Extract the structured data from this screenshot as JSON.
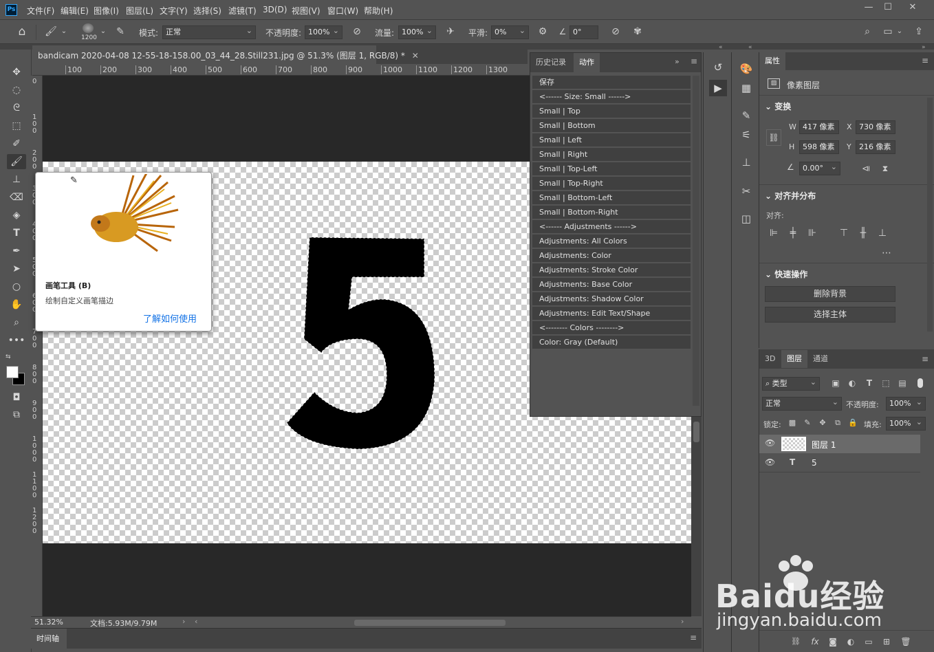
{
  "app": {
    "logo": "Ps"
  },
  "menu": [
    "文件(F)",
    "编辑(E)",
    "图像(I)",
    "图层(L)",
    "文字(Y)",
    "选择(S)",
    "滤镜(T)",
    "3D(D)",
    "视图(V)",
    "窗口(W)",
    "帮助(H)"
  ],
  "window_controls": {
    "minimize": "—",
    "maximize": "☐",
    "close": "✕"
  },
  "options": {
    "brush_size": "1200",
    "mode_label": "模式:",
    "mode_value": "正常",
    "opacity_label": "不透明度:",
    "opacity_value": "100%",
    "flow_label": "流量:",
    "flow_value": "100%",
    "smooth_label": "平滑:",
    "smooth_value": "0%",
    "angle_value": "0°"
  },
  "document": {
    "tab_title": "bandicam 2020-04-08 12-55-18-158.00_03_44_28.Still231.jpg @ 51.3% (图层 1, RGB/8) *",
    "ruler_h": [
      "100",
      "200",
      "300",
      "400",
      "500",
      "600",
      "700",
      "800",
      "900",
      "1000",
      "1100",
      "1200",
      "1300"
    ],
    "ruler_v": [
      "0",
      "100",
      "200",
      "300",
      "400",
      "500",
      "600",
      "700",
      "800",
      "900",
      "1000",
      "1100",
      "1200"
    ],
    "glyph": "5",
    "zoom": "51.32%",
    "doc_size": "文档:5.93M/9.79M"
  },
  "tooltip": {
    "title": "画笔工具 (B)",
    "desc": "绘制自定义画笔描边",
    "link": "了解如何使用"
  },
  "actions_panel": {
    "tabs": [
      "历史记录",
      "动作"
    ],
    "items": [
      "保存",
      "<------ Size: Small ------>",
      "Small | Top",
      "Small | Bottom",
      "Small | Left",
      "Small | Right",
      "Small | Top-Left",
      "Small | Top-Right",
      "Small | Bottom-Left",
      "Small | Bottom-Right",
      "<------ Adjustments ------>",
      "Adjustments: All Colors",
      "Adjustments: Color",
      "Adjustments: Stroke Color",
      "Adjustments: Base Color",
      "Adjustments: Shadow Color",
      "Adjustments: Edit Text/Shape",
      "<-------- Colors -------->",
      "Color: Gray (Default)"
    ]
  },
  "properties": {
    "tab": "属性",
    "layer_type": "像素图层",
    "transform_title": "变换",
    "w_label": "W",
    "w": "417 像素",
    "x_label": "X",
    "x": "730 像素",
    "h_label": "H",
    "h": "598 像素",
    "y_label": "Y",
    "y": "216 像素",
    "angle": "0.00°",
    "align_title": "对齐并分布",
    "align_label": "对齐:",
    "quick_title": "快速操作",
    "remove_bg": "删除背景",
    "select_subject": "选择主体"
  },
  "layers_panel": {
    "tabs": [
      "3D",
      "图层",
      "通道"
    ],
    "filter": "类型",
    "blend": "正常",
    "opacity_label": "不透明度:",
    "opacity": "100%",
    "lock_label": "锁定:",
    "fill_label": "填充:",
    "fill": "100%",
    "layers": [
      {
        "name": "图层 1",
        "type": "pixel"
      },
      {
        "name": "5",
        "type": "text"
      }
    ]
  },
  "timeline": {
    "label": "时间轴"
  },
  "watermark": {
    "brand": "Baidu经验",
    "url": "jingyan.baidu.com"
  },
  "colors": {
    "accent": "#31a8ff",
    "panel": "#535353",
    "dark": "#424242",
    "link": "#1473e6"
  }
}
